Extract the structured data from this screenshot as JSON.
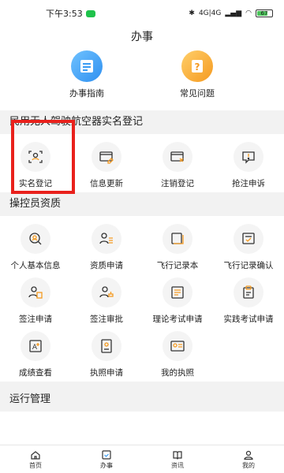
{
  "status": {
    "time": "下午3:53",
    "signal": "4G|4G",
    "battery": "67"
  },
  "header": {
    "title": "办事"
  },
  "top_links": [
    {
      "label": "办事指南",
      "icon": "guide-icon"
    },
    {
      "label": "常见问题",
      "icon": "question-icon"
    }
  ],
  "sections": [
    {
      "title": "民用无人驾驶航空器实名登记",
      "items": [
        {
          "label": "实名登记",
          "icon": "face-scan-icon"
        },
        {
          "label": "信息更新",
          "icon": "edit-doc-icon"
        },
        {
          "label": "注销登记",
          "icon": "cancel-doc-icon"
        },
        {
          "label": "抢注申诉",
          "icon": "appeal-icon"
        }
      ]
    },
    {
      "title": "操控员资质",
      "items": [
        {
          "label": "个人基本信息",
          "icon": "person-search-icon"
        },
        {
          "label": "资质申请",
          "icon": "person-list-icon"
        },
        {
          "label": "飞行记录本",
          "icon": "logbook-icon"
        },
        {
          "label": "飞行记录确认",
          "icon": "confirm-doc-icon"
        },
        {
          "label": "签注申请",
          "icon": "person-doc-icon"
        },
        {
          "label": "签注审批",
          "icon": "person-stamp-icon"
        },
        {
          "label": "理论考试申请",
          "icon": "exam-list-icon"
        },
        {
          "label": "实践考试申请",
          "icon": "clipboard-icon"
        },
        {
          "label": "成绩查看",
          "icon": "score-icon"
        },
        {
          "label": "执照申请",
          "icon": "license-apply-icon"
        },
        {
          "label": "我的执照",
          "icon": "license-card-icon"
        }
      ]
    },
    {
      "title": "运行管理",
      "items": []
    }
  ],
  "bottom_nav": [
    {
      "label": "首页",
      "icon": "home-icon"
    },
    {
      "label": "办事",
      "icon": "tasks-icon"
    },
    {
      "label": "资讯",
      "icon": "news-icon"
    },
    {
      "label": "我的",
      "icon": "profile-icon"
    }
  ],
  "colors": {
    "accent": "#f59a20",
    "highlight": "#e9211c",
    "icon_bg": "#f4f4f4"
  }
}
